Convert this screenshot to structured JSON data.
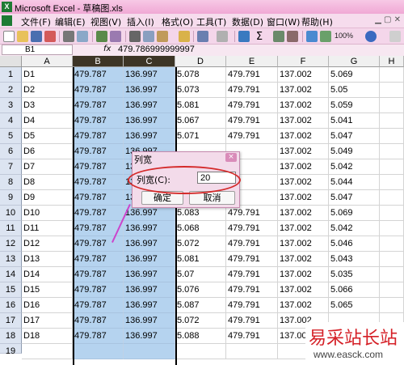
{
  "window": {
    "title": "Microsoft Excel - 草稿图.xls"
  },
  "menu": [
    "文件(F)",
    "编辑(E)",
    "视图(V)",
    "插入(I)",
    "格式(O)",
    "工具(T)",
    "数据(D)",
    "窗口(W)",
    "帮助(H)"
  ],
  "toolbar": {
    "zoom": "100%"
  },
  "formula_bar": {
    "name_box": "B1",
    "fx": "fx",
    "value": "479.786999999997"
  },
  "columns": [
    "A",
    "B",
    "C",
    "D",
    "E",
    "F",
    "G",
    "H"
  ],
  "rows": [
    [
      "D1",
      "479.787",
      "136.997",
      "5.078",
      "479.791",
      "137.002",
      "5.069"
    ],
    [
      "D2",
      "479.787",
      "136.997",
      "5.073",
      "479.791",
      "137.002",
      "5.05"
    ],
    [
      "D3",
      "479.787",
      "136.997",
      "5.081",
      "479.791",
      "137.002",
      "5.059"
    ],
    [
      "D4",
      "479.787",
      "136.997",
      "5.067",
      "479.791",
      "137.002",
      "5.041"
    ],
    [
      "D5",
      "479.787",
      "136.997",
      "5.071",
      "479.791",
      "137.002",
      "5.047"
    ],
    [
      "D6",
      "479.787",
      "136.997",
      "",
      "",
      "137.002",
      "5.049"
    ],
    [
      "D7",
      "479.787",
      "136.997",
      "",
      "",
      "137.002",
      "5.042"
    ],
    [
      "D8",
      "479.787",
      "136.997",
      "",
      "",
      "137.002",
      "5.044"
    ],
    [
      "D9",
      "479.787",
      "136.997",
      "",
      "",
      "137.002",
      "5.047"
    ],
    [
      "D10",
      "479.787",
      "136.997",
      "5.083",
      "479.791",
      "137.002",
      "5.069"
    ],
    [
      "D11",
      "479.787",
      "136.997",
      "5.068",
      "479.791",
      "137.002",
      "5.042"
    ],
    [
      "D12",
      "479.787",
      "136.997",
      "5.072",
      "479.791",
      "137.002",
      "5.046"
    ],
    [
      "D13",
      "479.787",
      "136.997",
      "5.081",
      "479.791",
      "137.002",
      "5.043"
    ],
    [
      "D14",
      "479.787",
      "136.997",
      "5.07",
      "479.791",
      "137.002",
      "5.035"
    ],
    [
      "D15",
      "479.787",
      "136.997",
      "5.076",
      "479.791",
      "137.002",
      "5.066"
    ],
    [
      "D16",
      "479.787",
      "136.997",
      "5.087",
      "479.791",
      "137.002",
      "5.065"
    ],
    [
      "D17",
      "479.787",
      "136.997",
      "5.072",
      "479.791",
      "137.002",
      ""
    ],
    [
      "D18",
      "479.787",
      "136.997",
      "5.088",
      "479.791",
      "137.002",
      ""
    ]
  ],
  "row_numbers": [
    "1",
    "2",
    "3",
    "4",
    "5",
    "6",
    "7",
    "8",
    "9",
    "10",
    "11",
    "12",
    "13",
    "14",
    "15",
    "16",
    "17",
    "18",
    "19"
  ],
  "dialog": {
    "title": "列宽",
    "close": "×",
    "label": "列宽(C):",
    "value": "20",
    "ok": "确定",
    "cancel": "取消"
  },
  "watermark": {
    "text": "易采站长站",
    "url": "www.easck.com"
  }
}
